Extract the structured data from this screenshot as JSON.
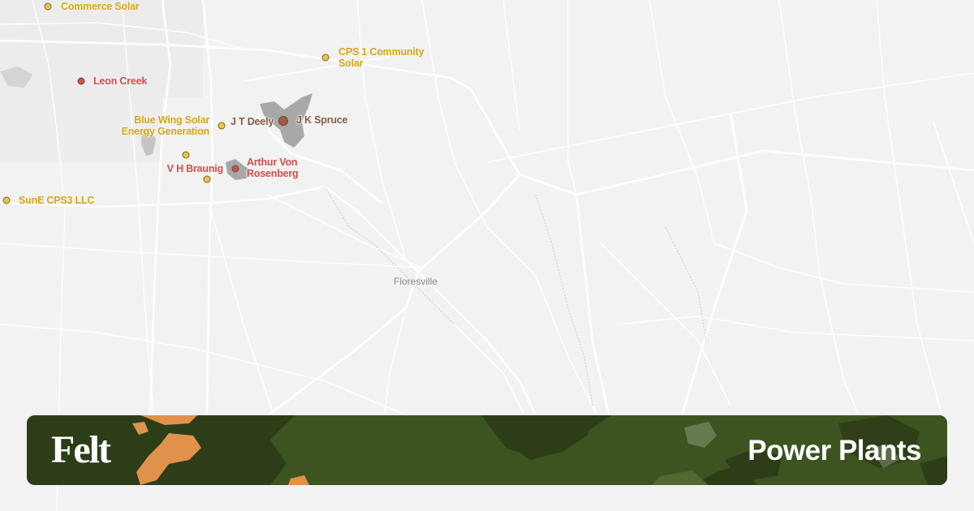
{
  "map": {
    "town": "Floresville",
    "colors": {
      "background": "#f2f2f2",
      "road": "#ffffff",
      "water": "#a9a9a9",
      "solar": "#e8c448",
      "gas": "#c9524f",
      "solar_label": "#d4a816",
      "gas_label": "#cf4e49",
      "coal_label": "#8b5a44"
    },
    "plants": [
      {
        "name": "Commerce Solar",
        "type": "solar"
      },
      {
        "name": "CPS 1 Community Solar",
        "line1": "CPS 1 Community",
        "line2": "Solar",
        "type": "solar"
      },
      {
        "name": "Leon Creek",
        "type": "gas"
      },
      {
        "name": "Blue Wing Solar Energy Generation",
        "line1": "Blue Wing Solar",
        "line2": "Energy Generation",
        "type": "solar"
      },
      {
        "name": "J T Deely",
        "type": "coal"
      },
      {
        "name": "J K Spruce",
        "type": "coal"
      },
      {
        "name": "V H Braunig",
        "type": "gas"
      },
      {
        "name": "Arthur Von Rosenberg",
        "line1": "Arthur Von",
        "line2": "Rosenberg",
        "type": "gas"
      },
      {
        "name": "SunE CPS3 LLC",
        "type": "solar"
      }
    ]
  },
  "banner": {
    "brand": "Felt",
    "title": "Power Plants",
    "colors": {
      "dark": "#2c3d18",
      "mid": "#3d5420",
      "light": "#54672f",
      "orange": "#e0914a",
      "grey": "#8a9a78"
    }
  }
}
